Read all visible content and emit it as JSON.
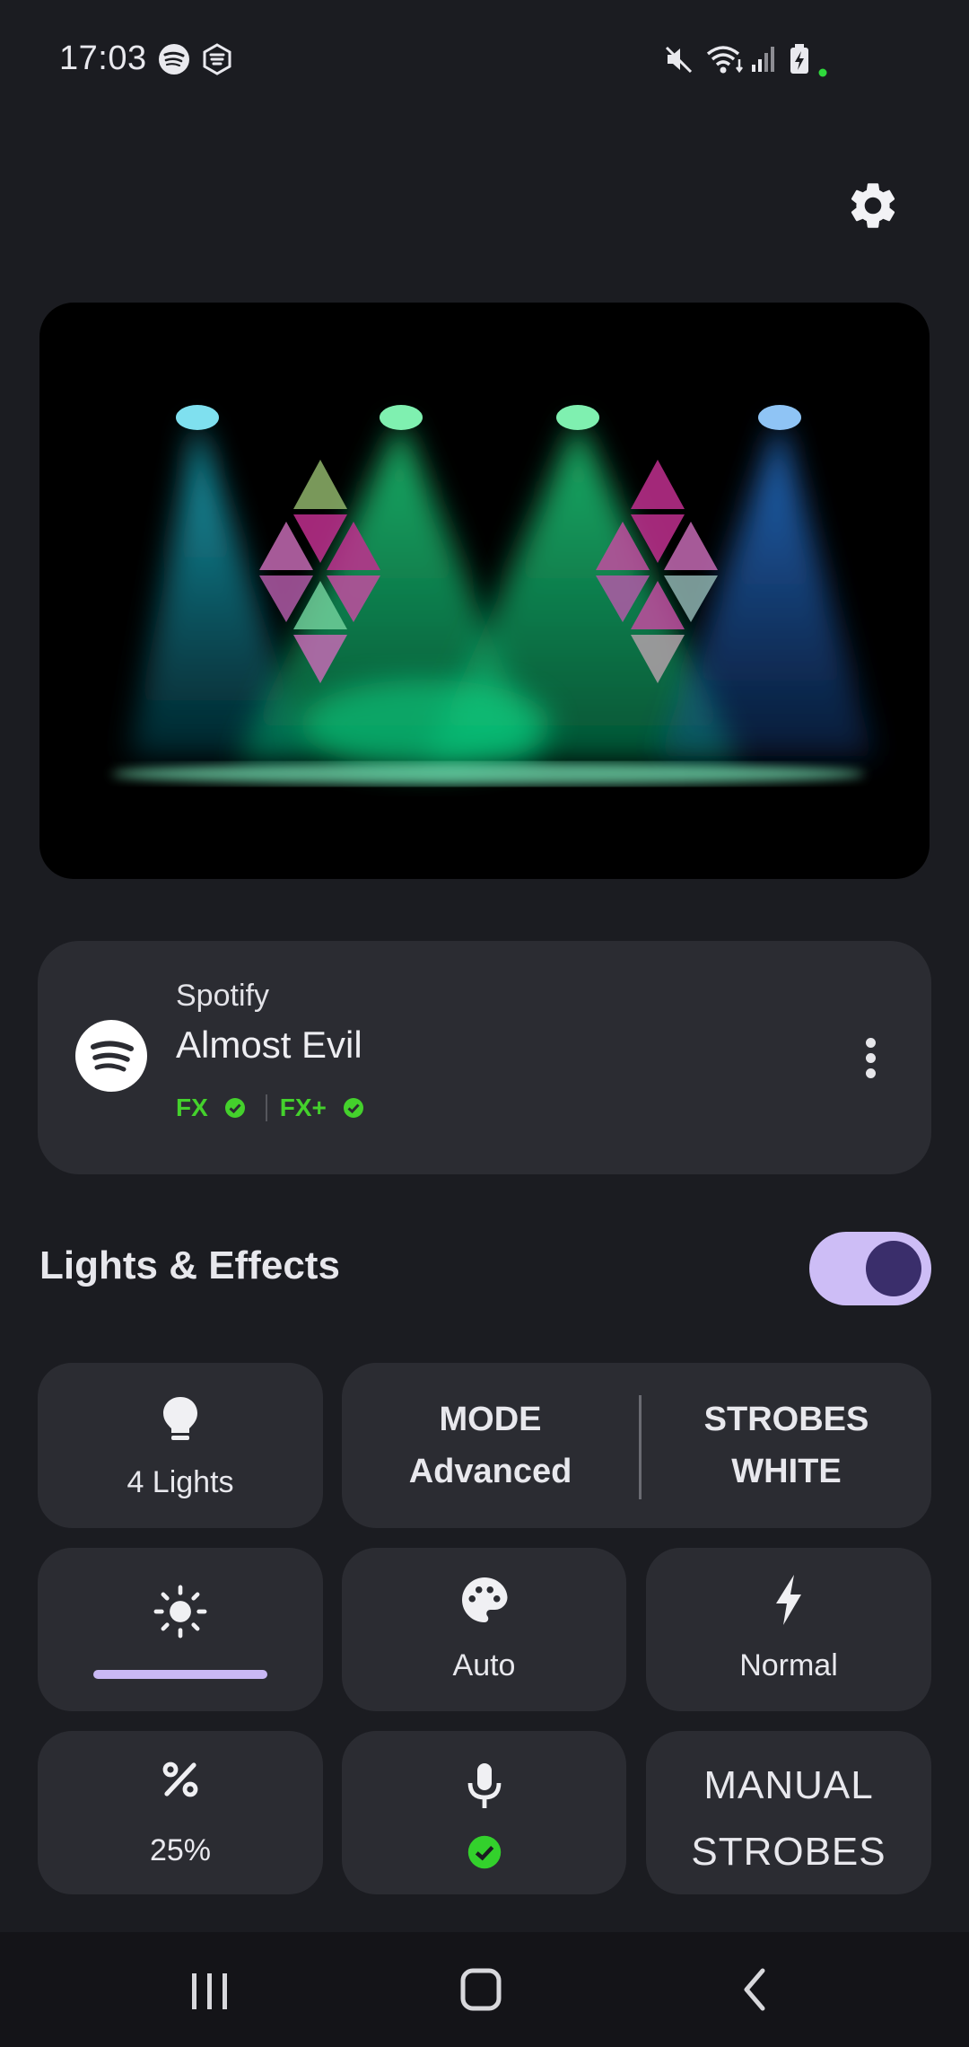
{
  "status_bar": {
    "time": "17:03",
    "notif_icons": [
      "spotify-icon",
      "nanoleaf-icon"
    ],
    "system_icons": [
      "mute-icon",
      "wifi-icon",
      "signal-icon",
      "battery-charging-icon"
    ]
  },
  "settings_icon": "gear-icon",
  "hero": {
    "description_icon": "stage-lights-illustration"
  },
  "now_playing": {
    "source": "Spotify",
    "track": "Almost Evil",
    "fx_label": "FX",
    "fx_plus_label": "FX+",
    "status_color": "#44d12c"
  },
  "lights_effects": {
    "title": "Lights & Effects",
    "enabled": true
  },
  "tiles": {
    "lights": {
      "label": "4 Lights",
      "icon": "bulb-icon"
    },
    "mode": {
      "title": "MODE",
      "value": "Advanced"
    },
    "strobes": {
      "title": "STROBES",
      "value": "WHITE"
    },
    "brightness": {
      "icon": "brightness-icon",
      "level": 1.0
    },
    "palette": {
      "label": "Auto",
      "icon": "palette-icon"
    },
    "speed": {
      "label": "Normal",
      "icon": "bolt-icon"
    },
    "percent": {
      "label": "25%",
      "icon": "percent-icon"
    },
    "mic": {
      "icon": "microphone-icon",
      "status_icon": "check-circle-icon"
    },
    "manual_strobes": {
      "line1": "MANUAL",
      "line2": "STROBES"
    }
  },
  "nav": {
    "buttons": [
      "recents-icon",
      "home-icon",
      "back-icon"
    ]
  },
  "colors": {
    "background": "#1b1c21",
    "card": "#2b2c32",
    "accent": "#cdbdf6",
    "toggle_knob": "#3a2e6b"
  }
}
